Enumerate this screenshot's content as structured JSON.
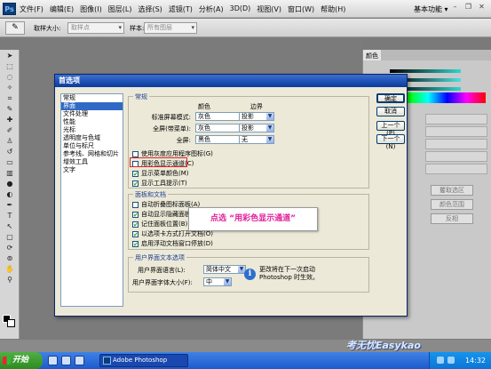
{
  "app": {
    "logo": "Ps",
    "menu": [
      "文件(F)",
      "编辑(E)",
      "图像(I)",
      "图层(L)",
      "选择(S)",
      "滤镜(T)",
      "分析(A)",
      "3D(D)",
      "视图(V)",
      "窗口(W)",
      "帮助(H)"
    ],
    "workspace": "基本功能",
    "workspace_caret": "▾"
  },
  "options_bar": {
    "sample_size_label": "取样大小:",
    "sample_size_value": "取样点",
    "sample_label": "样本:",
    "sample_value": "所有图层"
  },
  "right_panel": {
    "tab_color": "颜色",
    "buttons": [
      "矍取选区",
      "颜色范围",
      "反相"
    ]
  },
  "dialog": {
    "title": "首选项",
    "nav": [
      "常规",
      "界面",
      "文件处理",
      "性能",
      "光标",
      "透明度与色域",
      "单位与标尺",
      "参考线、网格和切片",
      "增效工具",
      "文字"
    ],
    "nav_selected_index": 1,
    "general": {
      "title": "常规",
      "col_color": "颜色",
      "col_border": "边界",
      "rows": [
        {
          "label": "标准屏幕模式:",
          "color": "灰色",
          "border": "投影"
        },
        {
          "label": "全屏(带菜单):",
          "color": "灰色",
          "border": "投影"
        },
        {
          "label": "全屏:",
          "color": "黑色",
          "border": "无"
        }
      ],
      "checks": [
        {
          "label": "使用灰度应用程序图标(G)",
          "checked": false
        },
        {
          "label": "用彩色显示通道(C)",
          "checked": false
        },
        {
          "label": "显示菜单颜色(M)",
          "checked": true
        },
        {
          "label": "显示工具提示(T)",
          "checked": true
        }
      ]
    },
    "panels": {
      "title": "面板和文档",
      "checks": [
        {
          "label": "自动折叠图标面板(A)",
          "checked": false
        },
        {
          "label": "自动显示隐藏面板(H)",
          "checked": true
        },
        {
          "label": "记住面板位置(B)",
          "checked": true
        },
        {
          "label": "以选项卡方式打开文档(O)",
          "checked": true
        },
        {
          "label": "启用浮动文档窗口停放(D)",
          "checked": true
        }
      ]
    },
    "ui_text": {
      "title": "用户界面文本选项",
      "language_label": "用户界面语言(L):",
      "language_value": "简体中文",
      "fontsize_label": "用户界面字体大小(F):",
      "fontsize_value": "中",
      "info": "更改将在下一次启动 Photoshop 时生效。"
    },
    "buttons": {
      "ok": "确定",
      "cancel": "取消",
      "prev": "上一个(P)",
      "next": "下一个(N)"
    },
    "callout": "点选 “用彩色显示通道”"
  },
  "taskbar": {
    "start": "开始",
    "task": "Adobe Photoshop",
    "clock": "14:32"
  },
  "watermark": "考无忧Easykao",
  "colors": {
    "dialog_bg": "#ece9d8",
    "title_blue": "#0a3a9c",
    "selected_nav": "#316ac5",
    "highlight_red": "#e02020",
    "callout_pink": "#e0209a"
  }
}
